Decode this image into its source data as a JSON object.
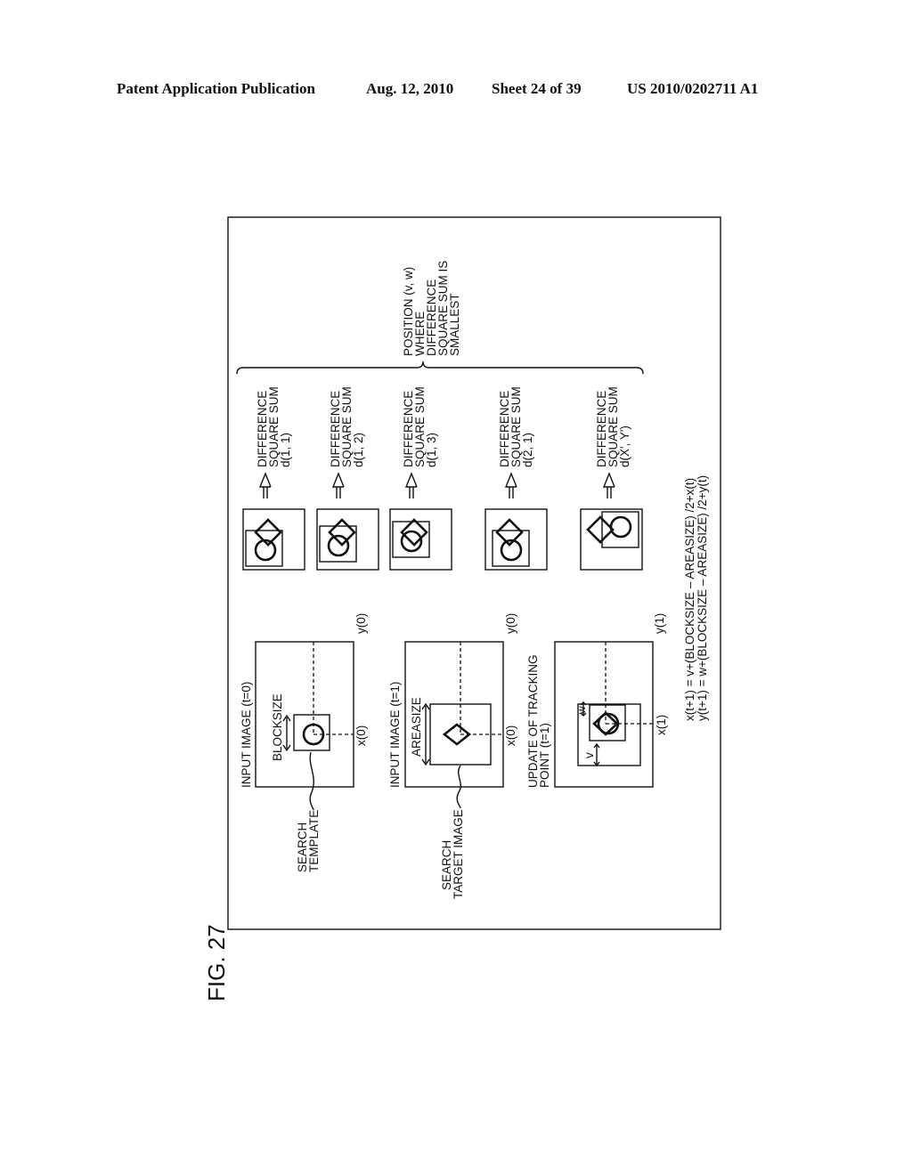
{
  "header": {
    "publication": "Patent Application Publication",
    "date": "Aug. 12, 2010",
    "sheet": "Sheet 24 of 39",
    "number": "US 2010/0202711 A1"
  },
  "figure": {
    "label": "FIG. 27",
    "panels": [
      {
        "title": "INPUT IMAGE (t=0)",
        "size_label": "BLOCKSIZE",
        "callout": [
          "SEARCH",
          "TEMPLATE"
        ],
        "x_label": "x(0)",
        "y_label": "y(0)"
      },
      {
        "title": "INPUT IMAGE (t=1)",
        "size_label": "AREASIZE",
        "callout": [
          "SEARCH",
          "TARGET IMAGE"
        ],
        "x_label": "x(0)",
        "y_label": "y(0)"
      },
      {
        "title": [
          "UPDATE OF TRACKING",
          "POINT (t=1)"
        ],
        "v_label": "v",
        "w_label": "w",
        "x_label": "x(1)",
        "y_label": "y(1)"
      }
    ],
    "differences": [
      {
        "line1": "DIFFERENCE",
        "line2": "SQUARE SUM",
        "line3": "d(1, 1)"
      },
      {
        "line1": "DIFFERENCE",
        "line2": "SQUARE SUM",
        "line3": "d(1, 2)"
      },
      {
        "line1": "DIFFERENCE",
        "line2": "SQUARE SUM",
        "line3": "d(1, 3)"
      },
      {
        "line1": "DIFFERENCE",
        "line2": "SQUARE SUM",
        "line3": "d(2, 1)"
      },
      {
        "line1": "DIFFERENCE",
        "line2": "SQUARE SUM",
        "line3": "d(X', Y')"
      }
    ],
    "brace_label": [
      "POSITION (v, w)",
      "WHERE",
      "DIFFERENCE",
      "SQUARE SUM IS",
      "SMALLEST"
    ],
    "formulas": [
      "x(t+1) = v+(BLOCKSIZE – AREASIZE) /2+x(t)",
      "y(t+1) = w+(BLOCKSIZE – AREASIZE) /2+y(t)"
    ]
  }
}
